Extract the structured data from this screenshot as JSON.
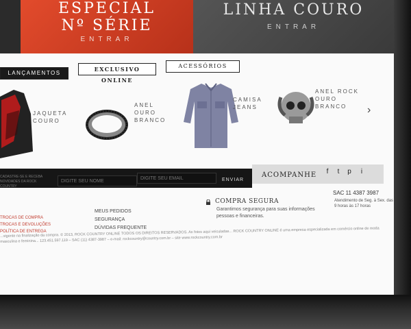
{
  "hero": {
    "banners": [
      {
        "line1": "ESPECIAL",
        "line2": "Nº SÉRIE",
        "cta": "ENTRAR"
      },
      {
        "line1": "LINHA COURO",
        "line2": "",
        "cta": "ENTRAR"
      }
    ]
  },
  "tabs": [
    {
      "label": "LANÇAMENTOS"
    },
    {
      "label": "EXCLUSIVO ONLINE"
    },
    {
      "label": "ACESSÓRIOS"
    }
  ],
  "products": [
    {
      "name": "JAQUETA COURO",
      "icon": "jacket-icon"
    },
    {
      "name": "ANEL OURO BRANCO",
      "icon": "ring-icon"
    },
    {
      "name": "CAMISA JEANS",
      "icon": "shirt-icon"
    },
    {
      "name": "ANEL ROCK OURO BRANCO",
      "icon": "skull-ring-icon"
    }
  ],
  "newsletter": {
    "hint": "CADASTRE-SE E RECEBA NOVIDADES DA ROCK COUNTRY",
    "name_placeholder": "DIGITE SEU NOME",
    "email_placeholder": "DIGITE SEU EMAIL",
    "send_label": "ENVIAR",
    "follow_label": "ACOMPANHE"
  },
  "social": [
    "f",
    "t",
    "p",
    "i"
  ],
  "footer": {
    "left_links": [
      "TROCAS DE COMPRA",
      "TROCAS E DEVOLUÇÕES",
      "POLÍTICA DE ENTREGA"
    ],
    "mid_links": [
      "MEUS PEDIDOS",
      "SEGURANÇA",
      "DÚVIDAS FREQUENTE"
    ],
    "secure_title": "COMPRA SEGURA",
    "secure_text": "Garantimos segurança para suas informações pessoas e financeiras.",
    "sac": "SAC 11 4387 3987",
    "hours": "Atendimento de Seg. à Sex. das 9 horas às 17 horas",
    "legal": "...vigente na finalização da compra. © 2013, ROCK COUNTRY ONLINE TODOS OS DIREITOS RESERVADOS. As fotos aqui veiculadas... ROCK COUNTRY ONLINE é uma empresa especializada em comércio online de moda masculina e feminina... 123.451.597.119 – SAC (11) 4387-3987 – e-mail: rockcountry@country.com.br – site www.rockcountry.com.br"
  },
  "colors": {
    "accent": "#e24b2c",
    "dark": "#161616"
  }
}
